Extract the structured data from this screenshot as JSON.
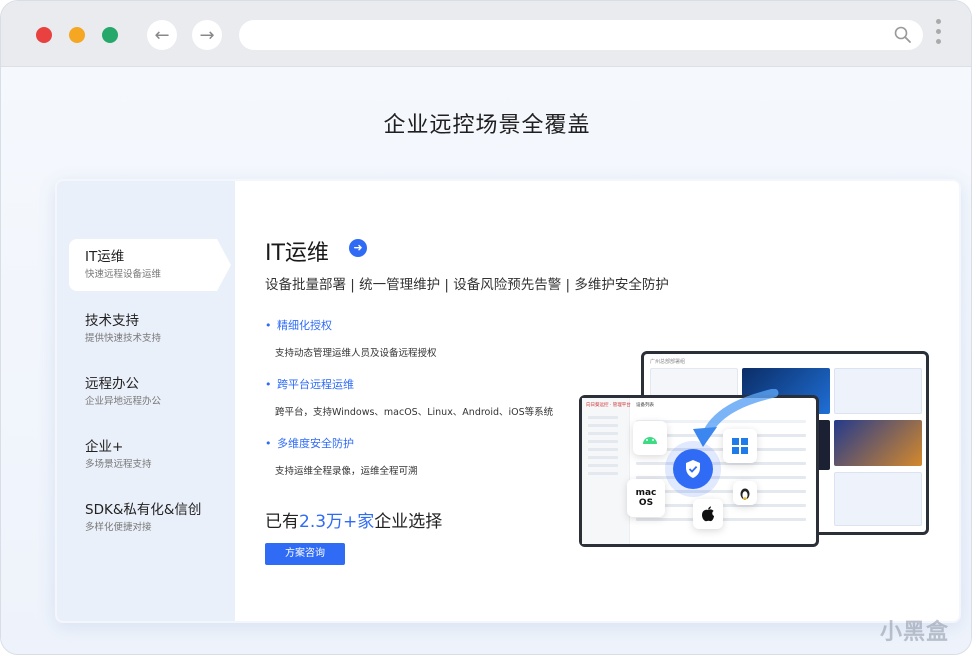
{
  "browser": {
    "back_label": "←",
    "forward_label": "→",
    "address": ""
  },
  "page": {
    "title": "企业远控场景全覆盖"
  },
  "sidebar": {
    "items": [
      {
        "title": "IT运维",
        "subtitle": "快速远程设备运维",
        "active": true
      },
      {
        "title": "技术支持",
        "subtitle": "提供快速技术支持"
      },
      {
        "title": "远程办公",
        "subtitle": "企业异地远程办公"
      },
      {
        "title": "企业+",
        "subtitle": "多场景远程支持"
      },
      {
        "title": "SDK&私有化&信创",
        "subtitle": "多样化便捷对接"
      }
    ]
  },
  "content": {
    "title": "IT运维",
    "subtitle": "设备批量部署 | 统一管理维护 | 设备风险预先告警 | 多维护安全防护",
    "features": [
      {
        "title": "精细化授权",
        "desc": "支持动态管理运维人员及设备远程授权"
      },
      {
        "title": "跨平台远程运维",
        "desc": "跨平台，支持Windows、macOS、Linux、Android、iOS等系统"
      },
      {
        "title": "多维度安全防护",
        "desc": "支持运维全程录像，运维全程可溯"
      }
    ],
    "stat_prefix": "已有",
    "stat_highlight": "2.3万+家",
    "stat_suffix": "企业选择",
    "cta_label": "方案咨询"
  },
  "illustration": {
    "back_window_title": "广州总部部署组",
    "front_window_title": "设备列表",
    "app_label": "向日葵远控 · 管理平台",
    "mac_icon_label": "mac OS"
  },
  "watermark": "小黑盒",
  "colors": {
    "accent": "#2f6bf5",
    "close": "#e8413f",
    "minimize": "#f5a623",
    "maximize": "#26a86a"
  }
}
